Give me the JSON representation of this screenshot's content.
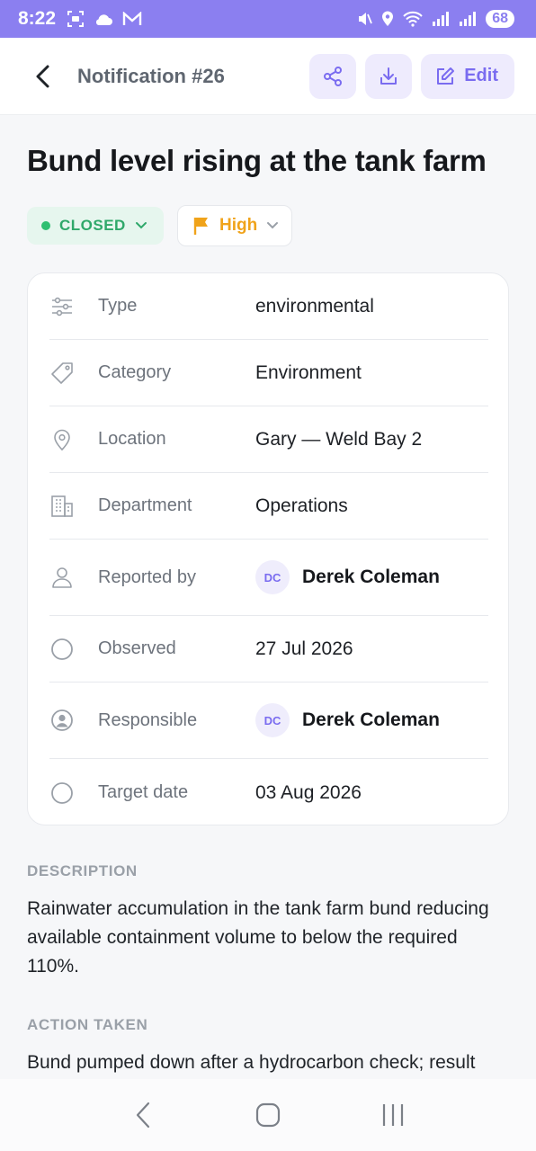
{
  "status_bar": {
    "time": "8:22",
    "battery": "68"
  },
  "header": {
    "title": "Notification #26",
    "edit_label": "Edit"
  },
  "notification": {
    "title": "Bund level rising at the tank farm",
    "status": "CLOSED",
    "priority": "High",
    "details": {
      "type": {
        "label": "Type",
        "value": "environmental"
      },
      "category": {
        "label": "Category",
        "value": "Environment"
      },
      "location": {
        "label": "Location",
        "value": "Gary — Weld Bay 2"
      },
      "department": {
        "label": "Department",
        "value": "Operations"
      },
      "reported_by": {
        "label": "Reported by",
        "initials": "DC",
        "value": "Derek Coleman"
      },
      "observed": {
        "label": "Observed",
        "value": "27 Jul 2026"
      },
      "responsible": {
        "label": "Responsible",
        "initials": "DC",
        "value": "Derek Coleman"
      },
      "target_date": {
        "label": "Target date",
        "value": "03 Aug 2026"
      }
    },
    "description": {
      "heading": "DESCRIPTION",
      "text": "Rainwater accumulation in the tank farm bund reducing available containment volume to below the required 110%."
    },
    "action_taken": {
      "heading": "ACTION TAKEN",
      "text": "Bund pumped down after a hydrocarbon check; result"
    }
  },
  "colors": {
    "accent": "#8b7ff0",
    "status_closed": "#2fa86a",
    "priority_high": "#f0a31a"
  }
}
